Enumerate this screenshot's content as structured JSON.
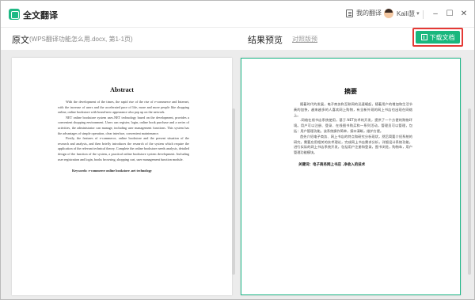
{
  "window": {
    "app_title": "全文翻译",
    "history_label": "我的翻译",
    "user_name": "Kaili慧",
    "controls": {
      "minimize": "–",
      "maximize": "☐",
      "close": "✕"
    }
  },
  "header": {
    "source_title": "原文",
    "source_file": "(WPS翻译功能怎么用.docx, 第1-1页)",
    "result_title": "结果预览",
    "compare_link": "对照版预",
    "download_label": "下载文档"
  },
  "original_page": {
    "title": "Abstract",
    "paragraphs": [
      "With the development of the times, the rapid rise of the rise of e-commerce and Internet, with the increase of users and the accelerated pace of life, more and more people like shopping online, online bookstore with brand-new appearance also pop up on the network.",
      "NET online bookstore system uses.NET technology based on the development, provides a convenient shopping environment. Users can register, login, online book purchase and a series of activities, the administrator can manage, including user management functions. This system has the advantages of simple operation, clear interface, convenient maintenance.",
      "Firstly, the features of e-commerce, online bookstore and the present situation of the research and analysis, and then briefly introduces the research of the system which require the application of the relevant technical theory. Complete the online bookstore needs analysis, detailed design of the function of the system, a practical online bookstore system development. Including user registration and login, books browsing, shopping cart, user management function module."
    ],
    "keywords": "Keywords: e-commerce online bookstore .net technology"
  },
  "translated_page": {
    "title": "摘要",
    "paragraphs": [
      "随着时代的发展，电子商务和互联网的迅速崛起，随着用户的增加和生活节奏的加快，越来越多的人喜欢网上购物，有全新外观的网上书店也出现在网络上。",
      ".网络在线书店系统使用，基于.NET技术的开发，提供了一个方便的购物环境。用户可以注册、登录、在线图书购买和一系列活动，管理员可以管理，包括：用户管理功能。该系统操作简单，接口清晰，维护方便。",
      "首先介绍电子商务、网上书店的特点和研究分析现状，然后简要介绍系统的研究，需要应用相关的技术理论，完成网上书店需求分析，详细设计系统功能，进行实际的网上书店系统开发，包括用户注册和登录，图书浏览，购物车，用户管理功能模块。"
    ],
    "keywords": "关键词：电子商务网上书店 .净收入的技术"
  }
}
